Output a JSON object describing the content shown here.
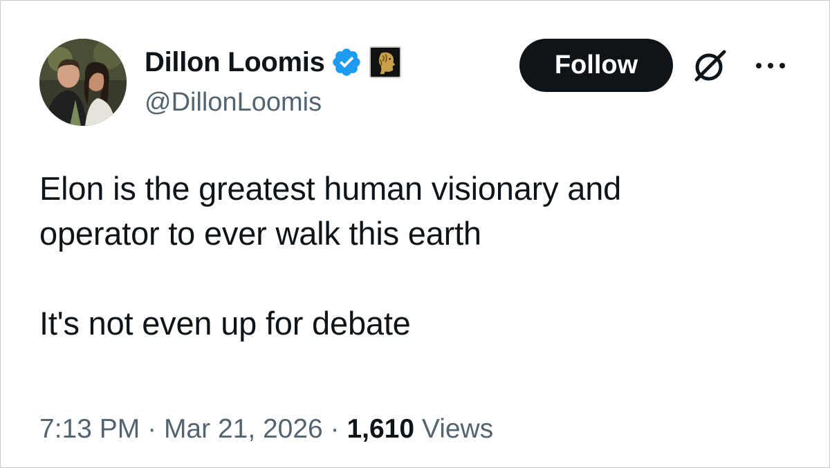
{
  "author": {
    "display_name": "Dillon Loomis",
    "handle": "@DillonLoomis",
    "verified_icon": "verified-badge-icon",
    "affiliation_icon": "lion-affiliation-icon",
    "avatar": "avatar-photo"
  },
  "actions": {
    "follow_label": "Follow",
    "grok_icon": "grok-icon",
    "more_icon": "more-icon"
  },
  "tweet": {
    "line1": "Elon is the greatest human visionary and",
    "line2": "operator to ever walk this earth",
    "line3": "It's not even up for debate"
  },
  "meta": {
    "time": "7:13 PM",
    "separator": "·",
    "date": "Mar 21, 2026",
    "views_count": "1,610",
    "views_label": "Views"
  },
  "colors": {
    "text": "#0f1419",
    "secondary": "#536471",
    "verified_blue": "#1d9bf0",
    "button_bg": "#0f1419"
  }
}
